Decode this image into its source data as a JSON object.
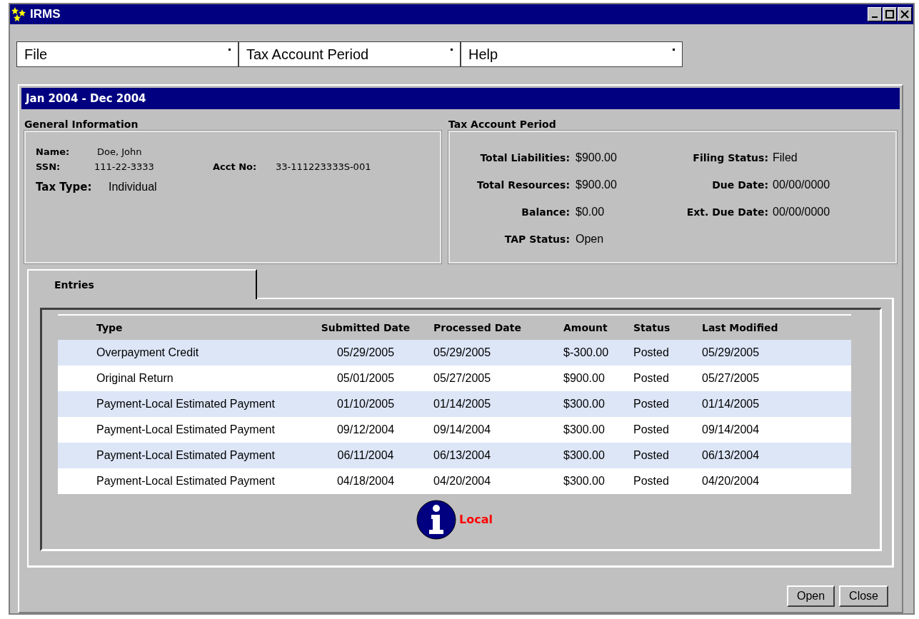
{
  "window": {
    "title": "IRMS"
  },
  "menus": [
    "File",
    "Tax Account Period",
    "Help"
  ],
  "period_header": "Jan 2004 - Dec 2004",
  "general_information": {
    "title": "General Information",
    "name_label": "Name:",
    "name": "Doe, John",
    "ssn_label": "SSN:",
    "ssn": "111-22-3333",
    "acct_label": "Acct No:",
    "acct": "33-111223333S-001",
    "tax_type_label": "Tax Type:",
    "tax_type": "Individual"
  },
  "tax_account_period": {
    "title": "Tax Account Period",
    "left": [
      {
        "label": "Total Liabilities:",
        "value": "$900.00"
      },
      {
        "label": "Total Resources:",
        "value": "$900.00"
      },
      {
        "label": "Balance:",
        "value": "$0.00"
      },
      {
        "label": "TAP Status:",
        "value": "Open"
      }
    ],
    "right": [
      {
        "label": "Filing Status:",
        "value": "Filed"
      },
      {
        "label": "Due Date:",
        "value": "00/00/0000"
      },
      {
        "label": "Ext. Due Date:",
        "value": "00/00/0000"
      }
    ]
  },
  "tabs": [
    {
      "label": "Entries",
      "selected": true
    }
  ],
  "table": {
    "columns": [
      "Type",
      "Submitted Date",
      "Processed Date",
      "Amount",
      "Status",
      "Last Modified"
    ],
    "rows": [
      [
        "Overpayment Credit",
        "05/29/2005",
        "05/29/2005",
        "$-300.00",
        "Posted",
        "05/29/2005"
      ],
      [
        "Original Return",
        "05/01/2005",
        "05/27/2005",
        "$900.00",
        "Posted",
        "05/27/2005"
      ],
      [
        "Payment-Local Estimated Payment",
        "01/10/2005",
        "01/14/2005",
        "$300.00",
        "Posted",
        "01/14/2005"
      ],
      [
        "Payment-Local Estimated Payment",
        "09/12/2004",
        "09/14/2004",
        "$300.00",
        "Posted",
        "09/14/2004"
      ],
      [
        "Payment-Local Estimated Payment",
        "06/11/2004",
        "06/13/2004",
        "$300.00",
        "Posted",
        "06/13/2004"
      ],
      [
        "Payment-Local Estimated Payment",
        "04/18/2004",
        "04/20/2004",
        "$300.00",
        "Posted",
        "04/20/2004"
      ]
    ]
  },
  "legend": {
    "label": "Local"
  },
  "buttons": [
    "Open",
    "Close"
  ]
}
